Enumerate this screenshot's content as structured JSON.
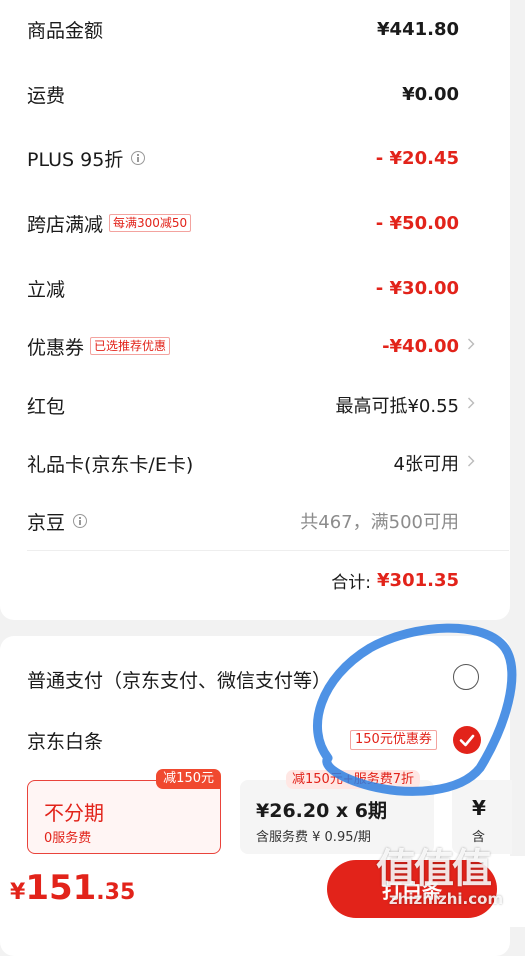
{
  "summary": {
    "rows": [
      {
        "label": "商品金额",
        "value": "¥441.80"
      },
      {
        "label": "运费",
        "value": "¥0.00"
      },
      {
        "label": "PLUS 95折",
        "value": "- ¥20.45"
      },
      {
        "label": "跨店满减",
        "tag": "每满300减50",
        "value": "- ¥50.00"
      },
      {
        "label": "立减",
        "value": "- ¥30.00"
      },
      {
        "label": "优惠券",
        "tag": "已选推荐优惠",
        "value": "-¥40.00"
      },
      {
        "label": "红包",
        "value": "最高可抵¥0.55"
      },
      {
        "label": "礼品卡(京东卡/E卡)",
        "value": "4张可用"
      },
      {
        "label": "京豆",
        "value": "共467，满500可用"
      }
    ],
    "total_label": "合计:",
    "total_value": "¥301.35"
  },
  "payment": {
    "option1_label": "普通支付（京东支付、微信支付等）",
    "option1_selected": false,
    "option2_label": "京东白条",
    "option2_tag": "150元优惠券",
    "option2_selected": true,
    "plans": [
      {
        "title": "不分期",
        "sub": "0服务费",
        "badge": "减150元",
        "selected": true
      },
      {
        "title": "¥26.20 x 6期",
        "sub": "含服务费 ¥ 0.95/期",
        "badge": "减150元+服务费7折",
        "selected": false
      },
      {
        "title": "¥",
        "sub": "含",
        "selected": false
      }
    ]
  },
  "bottom": {
    "currency": "¥",
    "price_int": "151",
    "price_dec": ".35",
    "pay_button": "打白条"
  },
  "watermark": {
    "logo": "值值值",
    "url": "zhizhizhi.com"
  },
  "colors": {
    "accent": "#e2231a",
    "annotation": "#2f7fe0"
  }
}
